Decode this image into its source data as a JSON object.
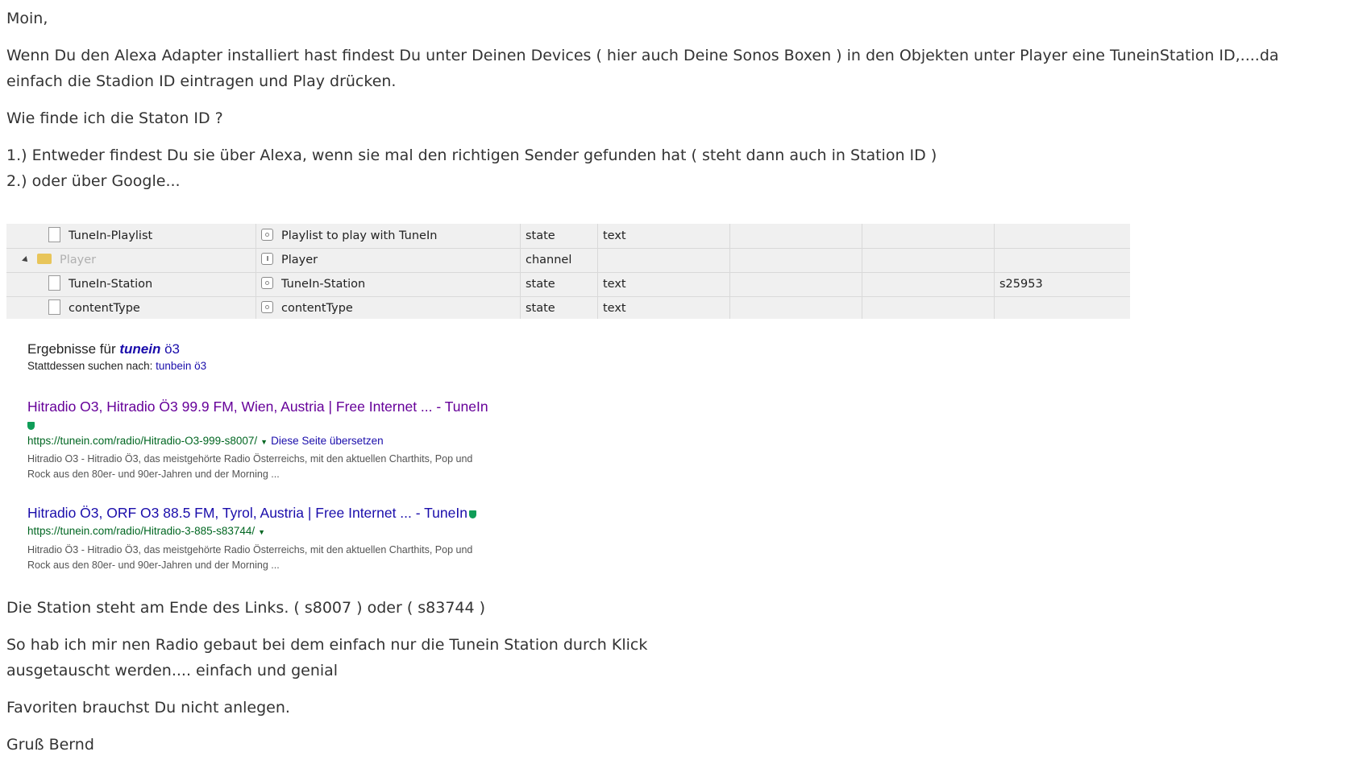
{
  "post": {
    "greeting": "Moin,",
    "intro_line1": "Wenn Du den Alexa Adapter installiert hast findest Du unter Deinen Devices ( hier auch Deine Sonos Boxen ) in den Objekten unter Player eine TuneinStation ID,....da",
    "intro_line2": "einfach die Stadion ID eintragen und Play drücken.",
    "question": "Wie finde ich die Staton ID ?",
    "option1": "1.) Entweder findest Du sie über Alexa, wenn sie mal den richtigen Sender gefunden hat ( steht dann auch in Station ID )",
    "option2": "2.) oder über Google...",
    "link_note": "Die Station steht am Ende des Links. ( s8007 ) oder ( s83744 )",
    "radio_line1": "So hab ich mir nen Radio gebaut bei dem einfach nur die Tunein Station durch Klick",
    "radio_line2": "ausgetauscht werden.... einfach und genial",
    "favorites": "Favoriten brauchst Du nicht anlegen.",
    "signature": "Gruß Bernd"
  },
  "object_table": {
    "rows": [
      {
        "name": "TuneIn-Playlist",
        "label": "Playlist to play with TuneIn",
        "type": "state",
        "role": "text",
        "value": "",
        "icon": "file-icon"
      },
      {
        "name": "Player",
        "label": "Player",
        "type": "channel",
        "role": "",
        "value": "",
        "icon": "folder-icon"
      },
      {
        "name": "TuneIn-Station",
        "label": "TuneIn-Station",
        "type": "state",
        "role": "text",
        "value": "s25953",
        "icon": "file-icon"
      },
      {
        "name": "contentType",
        "label": "contentType",
        "type": "state",
        "role": "text",
        "value": "",
        "icon": "file-icon"
      }
    ]
  },
  "google": {
    "results_for_prefix": "Ergebnisse für",
    "query_italic": "tunein",
    "query_rest": "ö3",
    "instead_prefix": "Stattdessen suchen nach:",
    "instead_query": "tunbein ö3",
    "results": [
      {
        "title": "Hitradio O3, Hitradio Ö3 99.9 FM, Wien, Austria | Free Internet ... - TuneIn",
        "url": "https://tunein.com/radio/Hitradio-O3-999-s8007/",
        "translate": "Diese Seite übersetzen",
        "snippet_line1": "Hitradio O3 - Hitradio Ö3, das meistgehörte Radio Österreichs, mit den aktuellen Charthits, Pop und",
        "snippet_line2": "Rock aus den 80er- und 90er-Jahren und der Morning ..."
      },
      {
        "title": "Hitradio Ö3, ORF O3 88.5 FM, Tyrol, Austria | Free Internet ... - TuneIn",
        "url": "https://tunein.com/radio/Hitradio-3-885-s83744/",
        "translate": "",
        "snippet_line1": "Hitradio Ö3 - Hitradio Ö3, das meistgehörte Radio Österreichs, mit den aktuellen Charthits, Pop und",
        "snippet_line2": "Rock aus den 80er- und 90er-Jahren und der Morning ..."
      }
    ]
  },
  "colors": {
    "text": "#333333",
    "link_blue": "#1a0dab",
    "visited_purple": "#660099",
    "url_green": "#006621",
    "snippet_gray": "#545454"
  }
}
